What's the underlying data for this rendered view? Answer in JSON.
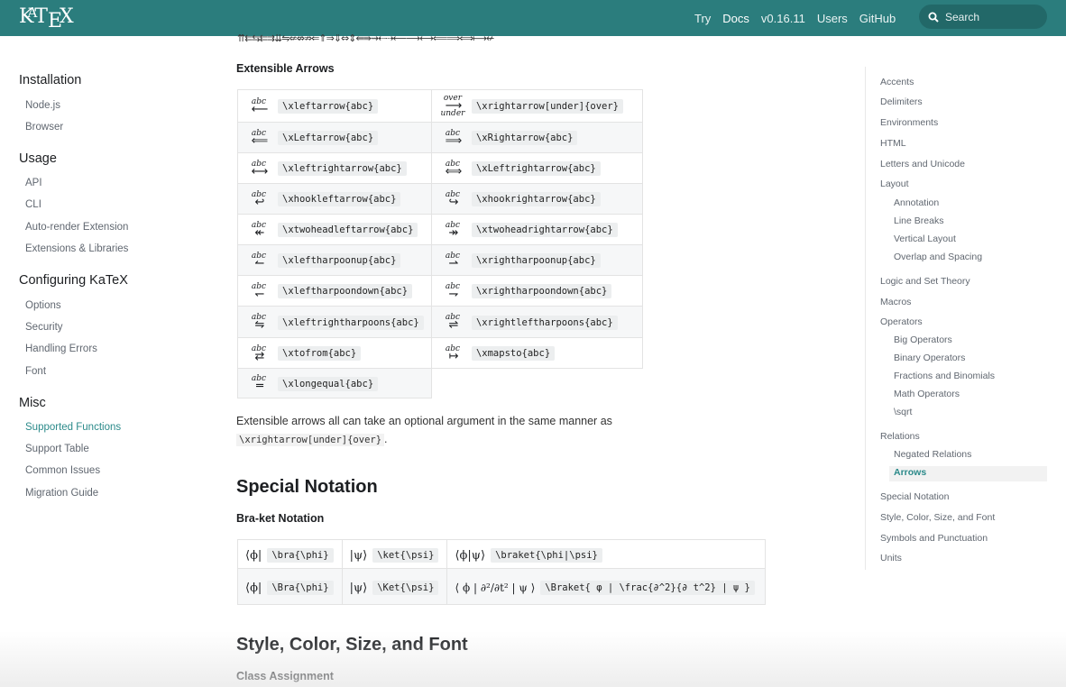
{
  "nav": {
    "logo": "KaTeX",
    "logo_parts": [
      "K",
      "A",
      "T",
      "E",
      "X"
    ],
    "links": [
      "Try",
      "Docs",
      "v0.16.11",
      "Users",
      "GitHub"
    ],
    "search_placeholder": "Search"
  },
  "sidebar": {
    "groups": [
      {
        "title": "Installation",
        "items": [
          "Node.js",
          "Browser"
        ]
      },
      {
        "title": "Usage",
        "items": [
          "API",
          "CLI",
          "Auto-render Extension",
          "Extensions & Libraries"
        ]
      },
      {
        "title": "Configuring KaTeX",
        "items": [
          "Options",
          "Security",
          "Handling Errors",
          "Font"
        ]
      },
      {
        "title": "Misc",
        "items": [
          "Supported Functions",
          "Support Table",
          "Common Issues",
          "Migration Guide"
        ]
      }
    ],
    "active_item": "Supported Functions"
  },
  "toc": {
    "items": [
      "Accents",
      "Delimiters",
      "Environments",
      "HTML",
      "Letters and Unicode",
      "Layout",
      "Annotation",
      "Line Breaks",
      "Vertical Layout",
      "Overlap and Spacing",
      "Logic and Set Theory",
      "Macros",
      "Operators",
      "Big Operators",
      "Binary Operators",
      "Fractions and Binomials",
      "Math Operators",
      "\\sqrt",
      "Relations",
      "Negated Relations",
      "Arrows",
      "Special Notation",
      "Style, Color, Size, and Font",
      "Symbols and Punctuation",
      "Units"
    ],
    "active_item": "Arrows"
  },
  "main": {
    "arrow_strip": "⇈⇇⇆⇇⇉⇊⇋⇍⇎⇏⇐⇑⇒⇓⇔⇕⇚⇛⇝⇠⇢⟵⟶⟷⟸⟹⟺⟼↚",
    "extensible_title": "Extensible Arrows",
    "extensible_rows": [
      [
        {
          "above": "abc",
          "below": "",
          "arrow": "⟵",
          "code": "\\xleftarrow{abc}"
        },
        {
          "above": "over",
          "below": "under",
          "arrow": "⟶",
          "code": "\\xrightarrow[under]{over}"
        }
      ],
      [
        {
          "above": "abc",
          "below": "",
          "arrow": "⟸",
          "code": "\\xLeftarrow{abc}"
        },
        {
          "above": "abc",
          "below": "",
          "arrow": "⟹",
          "code": "\\xRightarrow{abc}"
        }
      ],
      [
        {
          "above": "abc",
          "below": "",
          "arrow": "⟷",
          "code": "\\xleftrightarrow{abc}"
        },
        {
          "above": "abc",
          "below": "",
          "arrow": "⟺",
          "code": "\\xLeftrightarrow{abc}"
        }
      ],
      [
        {
          "above": "abc",
          "below": "",
          "arrow": "↩",
          "code": "\\xhookleftarrow{abc}"
        },
        {
          "above": "abc",
          "below": "",
          "arrow": "↪",
          "code": "\\xhookrightarrow{abc}"
        }
      ],
      [
        {
          "above": "abc",
          "below": "",
          "arrow": "↞",
          "code": "\\xtwoheadleftarrow{abc}"
        },
        {
          "above": "abc",
          "below": "",
          "arrow": "↠",
          "code": "\\xtwoheadrightarrow{abc}"
        }
      ],
      [
        {
          "above": "abc",
          "below": "",
          "arrow": "↼",
          "code": "\\xleftharpoonup{abc}"
        },
        {
          "above": "abc",
          "below": "",
          "arrow": "⇀",
          "code": "\\xrightharpoonup{abc}"
        }
      ],
      [
        {
          "above": "abc",
          "below": "",
          "arrow": "↽",
          "code": "\\xleftharpoondown{abc}"
        },
        {
          "above": "abc",
          "below": "",
          "arrow": "⇁",
          "code": "\\xrightharpoondown{abc}"
        }
      ],
      [
        {
          "above": "abc",
          "below": "",
          "arrow": "⇋",
          "code": "\\xleftrightharpoons{abc}"
        },
        {
          "above": "abc",
          "below": "",
          "arrow": "⇌",
          "code": "\\xrightleftharpoons{abc}"
        }
      ],
      [
        {
          "above": "abc",
          "below": "",
          "arrow": "⇄",
          "code": "\\xtofrom{abc}"
        },
        {
          "above": "abc",
          "below": "",
          "arrow": "↦",
          "code": "\\xmapsto{abc}"
        }
      ],
      [
        {
          "above": "abc",
          "below": "",
          "arrow": "═",
          "code": "\\xlongequal{abc}"
        },
        null
      ]
    ],
    "note_prefix": "Extensible arrows all can take an optional argument in the same manner as",
    "note_code": "\\xrightarrow[under]{over}",
    "note_suffix": ".",
    "special_title": "Special Notation",
    "braket_title": "Bra-ket Notation",
    "braket_rows": [
      [
        {
          "rendered": "⟨ϕ|",
          "code": "\\bra{\\phi}"
        },
        {
          "rendered": "|ψ⟩",
          "code": "\\ket{\\psi}"
        },
        {
          "rendered": "⟨ϕ|ψ⟩",
          "code": "\\braket{\\phi|\\psi}"
        }
      ],
      [
        {
          "rendered": "⟨ϕ|",
          "code": "\\Bra{\\phi}"
        },
        {
          "rendered": "|ψ⟩",
          "code": "\\Ket{\\psi}"
        },
        {
          "rendered": "⟨ ϕ | ∂²/∂t² | ψ ⟩",
          "code": "\\Braket{ φ | \\frac{∂^2}{∂ t^2} | ψ }"
        }
      ]
    ],
    "style_title": "Style, Color, Size, and Font",
    "class_title": "Class Assignment"
  }
}
